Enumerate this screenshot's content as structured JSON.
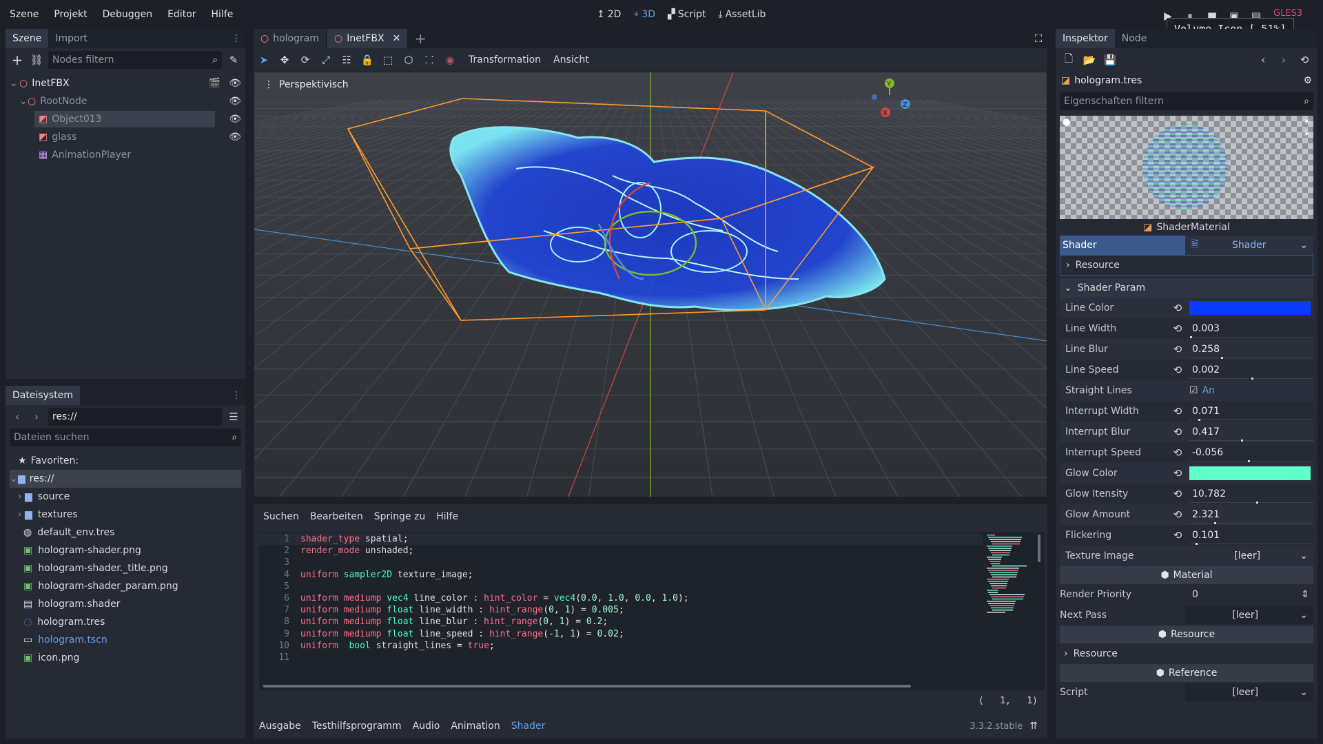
{
  "menubar": {
    "items": [
      "Szene",
      "Projekt",
      "Debuggen",
      "Editor",
      "Hilfe"
    ],
    "workspaces": [
      "2D",
      "3D",
      "Script",
      "AssetLib"
    ],
    "renderer": "GLES3"
  },
  "tooltip": "Volume Icon [ 51%]",
  "scene_dock": {
    "tabs": [
      "Szene",
      "Import"
    ],
    "filter_placeholder": "Nodes filtern",
    "nodes": [
      {
        "name": "InetFBX",
        "type": "root",
        "icon": "node3d-icon",
        "depth": 0
      },
      {
        "name": "RootNode",
        "type": "spatial",
        "icon": "spatial-icon",
        "depth": 1
      },
      {
        "name": "Object013",
        "type": "mesh",
        "icon": "mesh-instance-icon",
        "depth": 2,
        "selected": true
      },
      {
        "name": "glass",
        "type": "mesh",
        "icon": "mesh-instance-icon",
        "depth": 2
      },
      {
        "name": "AnimationPlayer",
        "type": "animation",
        "icon": "animation-player-icon",
        "depth": 2
      }
    ]
  },
  "filesystem_dock": {
    "title": "Dateisystem",
    "path": "res://",
    "search_placeholder": "Dateien suchen",
    "favorites_label": "Favoriten:",
    "root_label": "res://",
    "entries": [
      {
        "name": "source",
        "kind": "folder"
      },
      {
        "name": "textures",
        "kind": "folder"
      },
      {
        "name": "default_env.tres",
        "kind": "env"
      },
      {
        "name": "hologram-shader.png",
        "kind": "image"
      },
      {
        "name": "hologram-shader._title.png",
        "kind": "image"
      },
      {
        "name": "hologram-shader_param.png",
        "kind": "image"
      },
      {
        "name": "hologram.shader",
        "kind": "shader"
      },
      {
        "name": "hologram.tres",
        "kind": "material"
      },
      {
        "name": "hologram.tscn",
        "kind": "scene"
      },
      {
        "name": "icon.png",
        "kind": "image"
      }
    ]
  },
  "editor_tabs": [
    {
      "label": "hologram",
      "active": false
    },
    {
      "label": "InetFBX",
      "active": true
    }
  ],
  "viewport_toolbar": {
    "menus": [
      "Transformation",
      "Ansicht"
    ],
    "view_label": "Perspektivisch"
  },
  "shader_editor": {
    "menus": [
      "Suchen",
      "Bearbeiten",
      "Springe zu",
      "Hilfe"
    ],
    "lines": [
      {
        "n": "1",
        "tokens": [
          [
            "kw",
            "shader_type"
          ],
          [
            "tx",
            " spatial;"
          ]
        ]
      },
      {
        "n": "2",
        "tokens": [
          [
            "kw",
            "render_mode"
          ],
          [
            "tx",
            " unshaded;"
          ]
        ]
      },
      {
        "n": "3",
        "tokens": []
      },
      {
        "n": "4",
        "tokens": [
          [
            "kw",
            "uniform"
          ],
          [
            "tx",
            " "
          ],
          [
            "ty",
            "sampler2D"
          ],
          [
            "tx",
            " texture_image;"
          ]
        ]
      },
      {
        "n": "5",
        "tokens": []
      },
      {
        "n": "6",
        "tokens": [
          [
            "kw",
            "uniform"
          ],
          [
            "tx",
            " "
          ],
          [
            "kw",
            "mediump"
          ],
          [
            "tx",
            " "
          ],
          [
            "ty",
            "vec4"
          ],
          [
            "tx",
            " line_color : "
          ],
          [
            "kw",
            "hint_color"
          ],
          [
            "tx",
            " = "
          ],
          [
            "ty",
            "vec4"
          ],
          [
            "tx",
            "("
          ],
          [
            "nm",
            "0.0"
          ],
          [
            "tx",
            ", "
          ],
          [
            "nm",
            "1.0"
          ],
          [
            "tx",
            ", "
          ],
          [
            "nm",
            "0.0"
          ],
          [
            "tx",
            ", "
          ],
          [
            "nm",
            "1.0"
          ],
          [
            "tx",
            ");"
          ]
        ]
      },
      {
        "n": "7",
        "tokens": [
          [
            "kw",
            "uniform"
          ],
          [
            "tx",
            " "
          ],
          [
            "kw",
            "mediump"
          ],
          [
            "tx",
            " "
          ],
          [
            "ty",
            "float"
          ],
          [
            "tx",
            " line_width : "
          ],
          [
            "kw",
            "hint_range"
          ],
          [
            "tx",
            "("
          ],
          [
            "nm",
            "0"
          ],
          [
            "tx",
            ", "
          ],
          [
            "nm",
            "1"
          ],
          [
            "tx",
            ") = "
          ],
          [
            "nm",
            "0.005"
          ],
          [
            "tx",
            ";"
          ]
        ]
      },
      {
        "n": "8",
        "tokens": [
          [
            "kw",
            "uniform"
          ],
          [
            "tx",
            " "
          ],
          [
            "kw",
            "mediump"
          ],
          [
            "tx",
            " "
          ],
          [
            "ty",
            "float"
          ],
          [
            "tx",
            " line_blur : "
          ],
          [
            "kw",
            "hint_range"
          ],
          [
            "tx",
            "("
          ],
          [
            "nm",
            "0"
          ],
          [
            "tx",
            ", "
          ],
          [
            "nm",
            "1"
          ],
          [
            "tx",
            ") = "
          ],
          [
            "nm",
            "0.2"
          ],
          [
            "tx",
            ";"
          ]
        ]
      },
      {
        "n": "9",
        "tokens": [
          [
            "kw",
            "uniform"
          ],
          [
            "tx",
            " "
          ],
          [
            "kw",
            "mediump"
          ],
          [
            "tx",
            " "
          ],
          [
            "ty",
            "float"
          ],
          [
            "tx",
            " line_speed : "
          ],
          [
            "kw",
            "hint_range"
          ],
          [
            "tx",
            "(-"
          ],
          [
            "nm",
            "1"
          ],
          [
            "tx",
            ", "
          ],
          [
            "nm",
            "1"
          ],
          [
            "tx",
            ") = "
          ],
          [
            "nm",
            "0.02"
          ],
          [
            "tx",
            ";"
          ]
        ]
      },
      {
        "n": "10",
        "tokens": [
          [
            "kw",
            "uniform"
          ],
          [
            "tx",
            "  "
          ],
          [
            "ty",
            "bool"
          ],
          [
            "tx",
            " straight_lines = "
          ],
          [
            "kw",
            "true"
          ],
          [
            "tx",
            ";"
          ]
        ]
      },
      {
        "n": "11",
        "tokens": []
      }
    ],
    "cursor": "(   1,   1)"
  },
  "bottom_panel": {
    "tabs": [
      "Ausgabe",
      "Testhilfsprogramm",
      "Audio",
      "Animation",
      "Shader"
    ],
    "active": "Shader",
    "version": "3.3.2.stable"
  },
  "inspector": {
    "tabs": [
      "Inspektor",
      "Node"
    ],
    "resource": "hologram.tres",
    "filter_placeholder": "Eigenschaften filtern",
    "preview_label": "ShaderMaterial",
    "shader_label": "Shader",
    "shader_value": "Shader",
    "resource_label": "Resource",
    "shader_param_label": "Shader Param",
    "params": [
      {
        "label": "Line Color",
        "kind": "color",
        "color": "#0a3bff"
      },
      {
        "label": "Line Width",
        "kind": "number",
        "value": "0.003",
        "fill": 0.003
      },
      {
        "label": "Line Blur",
        "kind": "number",
        "value": "0.258",
        "fill": 0.258
      },
      {
        "label": "Line Speed",
        "kind": "number",
        "value": "0.002",
        "fill": 0.501
      },
      {
        "label": "Straight Lines",
        "kind": "bool",
        "value": "An"
      },
      {
        "label": "Interrupt Width",
        "kind": "number",
        "value": "0.071",
        "fill": 0.071
      },
      {
        "label": "Interrupt Blur",
        "kind": "number",
        "value": "0.417",
        "fill": 0.417
      },
      {
        "label": "Interrupt Speed",
        "kind": "number",
        "value": "-0.056",
        "fill": 0.472
      },
      {
        "label": "Glow Color",
        "kind": "color",
        "color": "#5effc8"
      },
      {
        "label": "Glow Itensity",
        "kind": "number",
        "value": "10.782",
        "fill": 0.54
      },
      {
        "label": "Glow Amount",
        "kind": "number",
        "value": "2.321",
        "fill": 0.2
      },
      {
        "label": "Flickering",
        "kind": "number",
        "value": "0.101",
        "fill": 0.05
      },
      {
        "label": "Texture Image",
        "kind": "resource",
        "value": "[leer]"
      }
    ],
    "material_section": "Material",
    "render_priority_label": "Render Priority",
    "render_priority_value": "0",
    "next_pass_label": "Next Pass",
    "next_pass_value": "[leer]",
    "resource_section": "Resource",
    "resource_sub_label": "Resource",
    "reference_section": "Reference",
    "script_label": "Script",
    "script_value": "[leer]"
  },
  "colors": {
    "accent": "#699ce8",
    "selection_box": "#ff9a2e",
    "hologram": "#4fd7ff"
  }
}
